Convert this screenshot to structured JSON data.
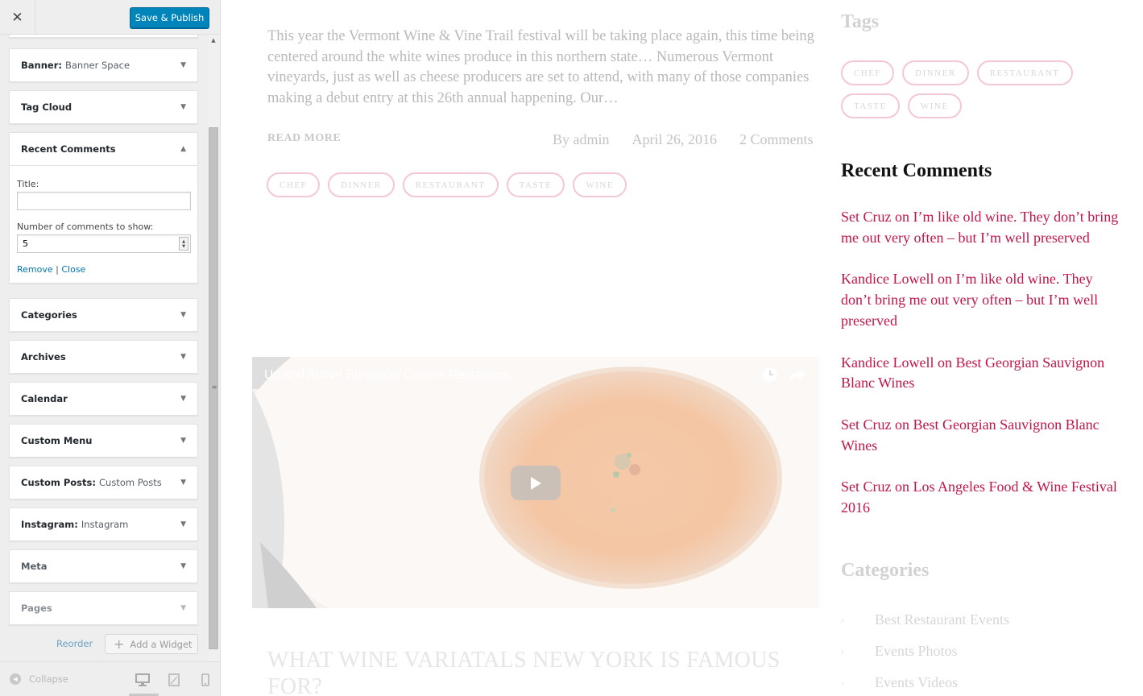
{
  "customizer": {
    "close_icon": "close-icon",
    "save_label": "Save & Publish",
    "widgets": [
      {
        "name": "Banner:",
        "sub": "Banner Space"
      },
      {
        "name": "Tag Cloud",
        "sub": ""
      },
      {
        "name": "Recent Comments",
        "sub": ""
      },
      {
        "name": "Categories",
        "sub": ""
      },
      {
        "name": "Archives",
        "sub": ""
      },
      {
        "name": "Calendar",
        "sub": ""
      },
      {
        "name": "Custom Menu",
        "sub": ""
      },
      {
        "name": "Custom Posts:",
        "sub": "Custom Posts"
      },
      {
        "name": "Instagram:",
        "sub": "Instagram"
      },
      {
        "name": "Meta",
        "sub": ""
      },
      {
        "name": "Pages",
        "sub": ""
      }
    ],
    "recent_comments_form": {
      "title_label": "Title:",
      "title_value": "",
      "number_label": "Number of comments to show:",
      "number_value": "5",
      "remove_label": "Remove",
      "separator": "|",
      "close_label": "Close"
    },
    "reorder_label": "Reorder",
    "add_widget_label": "Add a Widget",
    "collapse_label": "Collapse"
  },
  "preview": {
    "excerpt": "This year the Vermont Wine & Vine Trail festival will be taking place again, this time being centered around the white wines produce in this northern state… Numerous Vermont vineyards, just as well as cheese producers are set to attend, with many of those companies making a debut entry at this 26th annual happening. Our…",
    "read_more": "READ MORE",
    "author": "By admin",
    "date": "April 26, 2016",
    "comments": "2 Comments",
    "post_tags": [
      "CHEF",
      "DINNER",
      "RESTAURANT",
      "TASTE",
      "WINE"
    ],
    "video_title": "Up and Above European Cuisine Restaurant",
    "next_post_title": "WHAT WINE VARIATALS NEW YORK IS FAMOUS FOR?",
    "sidebar": {
      "tags_heading": "Tags",
      "tags": [
        "CHEF",
        "DINNER",
        "RESTAURANT",
        "TASTE",
        "WINE"
      ],
      "recent_comments_heading": "Recent Comments",
      "recent_comments": [
        "Set Cruz on I’m like old wine. They don’t bring me out very often – but I’m well preserved",
        "Kandice Lowell on I’m like old wine. They don’t bring me out very often – but I’m well preserved",
        "Kandice Lowell on Best Georgian Sauvignon Blanc Wines",
        "Set Cruz on Best Georgian Sauvignon Blanc Wines",
        "Set Cruz on Los Angeles Food & Wine Festival 2016"
      ],
      "categories_heading": "Categories",
      "categories": [
        "Best Restaurant Events",
        "Events Photos",
        "Events Videos"
      ]
    }
  },
  "colors": {
    "primary_button": "#0085ba",
    "link_blue": "#0073aa",
    "comment_link": "#c0154a",
    "tag_border": "#f3c8d3"
  }
}
